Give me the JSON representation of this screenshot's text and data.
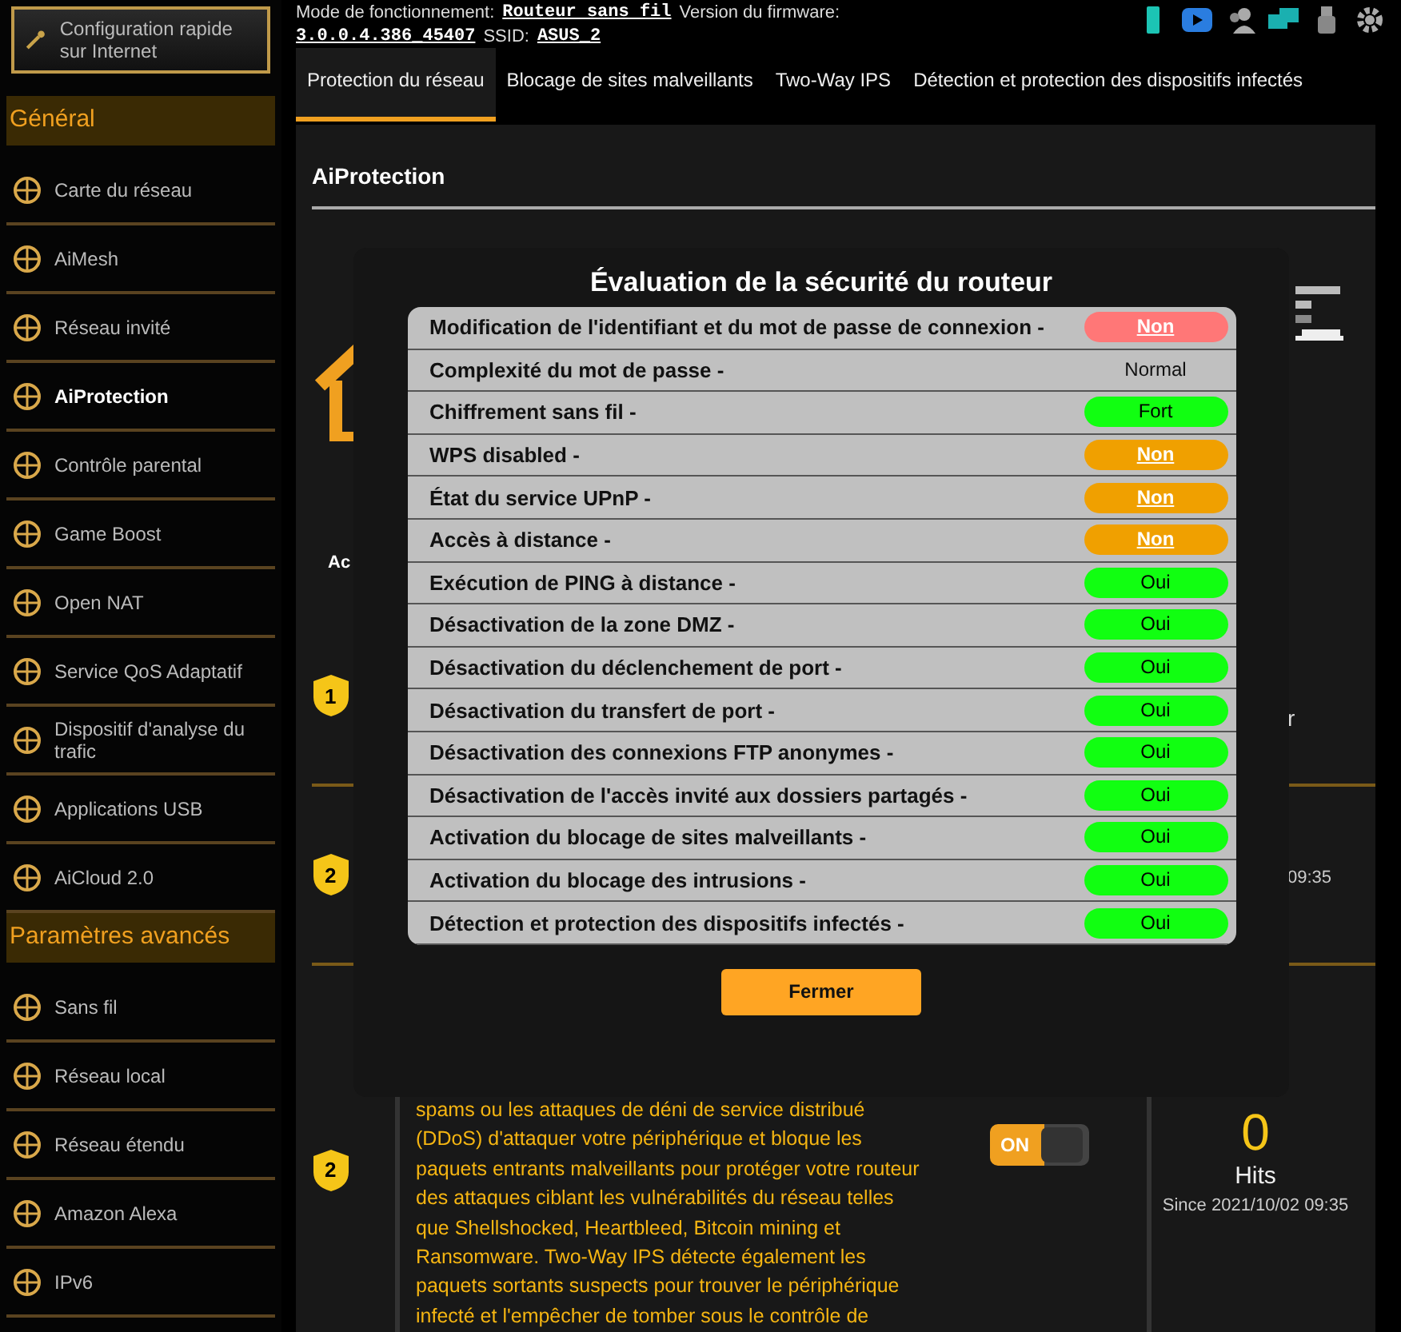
{
  "quick_setup": {
    "label": "Configuration rapide sur Internet"
  },
  "sidebar": {
    "sections": [
      {
        "title": "Général",
        "items": [
          {
            "label": "Carte du réseau",
            "selected": false
          },
          {
            "label": "AiMesh",
            "selected": false
          },
          {
            "label": "Réseau invité",
            "selected": false
          },
          {
            "label": "AiProtection",
            "selected": true
          },
          {
            "label": "Contrôle parental",
            "selected": false
          },
          {
            "label": "Game Boost",
            "selected": false
          },
          {
            "label": "Open NAT",
            "selected": false
          },
          {
            "label": "Service QoS Adaptatif",
            "selected": false
          },
          {
            "label": "Dispositif d'analyse du trafic",
            "selected": false
          },
          {
            "label": "Applications USB",
            "selected": false
          },
          {
            "label": "AiCloud 2.0",
            "selected": false
          }
        ]
      },
      {
        "title": "Paramètres avancés",
        "items": [
          {
            "label": "Sans fil",
            "selected": false
          },
          {
            "label": "Réseau local",
            "selected": false
          },
          {
            "label": "Réseau étendu",
            "selected": false
          },
          {
            "label": "Amazon Alexa",
            "selected": false
          },
          {
            "label": "IPv6",
            "selected": false
          }
        ]
      }
    ]
  },
  "header": {
    "mode_label": "Mode de fonctionnement:",
    "mode_value": "Routeur sans fil",
    "version_label": "Version du firmware:",
    "version_value": "3.0.0.4.386_45407",
    "ssid_label": "SSID:",
    "ssid_value": "ASUS_2"
  },
  "tabs": [
    {
      "label": "Protection du réseau",
      "selected": true
    },
    {
      "label": "Blocage de sites malveillants",
      "selected": false
    },
    {
      "label": "Two-Way IPS",
      "selected": false
    },
    {
      "label": "Détection et protection des dispositifs infectés",
      "selected": false
    }
  ],
  "panel": {
    "title": "AiProtection",
    "enable_label": "Ac",
    "cards": [
      {
        "badge": "1",
        "kind": "danger",
        "status": "r"
      },
      {
        "badge": "2",
        "kind": "hits",
        "since": "09:35"
      },
      {
        "badge": "2",
        "kind": "hits",
        "description": "spams ou les attaques de déni de service distribué (DDoS) d'attaquer votre périphérique et bloque les paquets entrants malveillants pour protéger votre routeur des attaques ciblant les vulnérabilités du réseau telles que Shellshocked, Heartbleed, Bitcoin mining et Ransomware. Two-Way IPS détecte également les paquets sortants suspects pour trouver le périphérique infecté et l'empêcher de tomber sous le contrôle de",
        "toggle": {
          "label": "ON",
          "on": true
        },
        "count": "0",
        "status": "Hits",
        "since": "Since 2021/10/02 09:35"
      }
    ]
  },
  "modal": {
    "title": "Évaluation de la sécurité du routeur",
    "rows": [
      {
        "label": "Modification de l'identifiant et du mot de passe de connexion -",
        "value": "Non",
        "kind": "bad"
      },
      {
        "label": "Complexité du mot de passe -",
        "value": "Normal",
        "kind": "plain"
      },
      {
        "label": "Chiffrement sans fil -",
        "value": "Fort",
        "kind": "good"
      },
      {
        "label": "WPS disabled -",
        "value": "Non",
        "kind": "warn"
      },
      {
        "label": "État du service UPnP -",
        "value": "Non",
        "kind": "warn"
      },
      {
        "label": "Accès à distance -",
        "value": "Non",
        "kind": "warn"
      },
      {
        "label": "Exécution de PING à distance -",
        "value": "Oui",
        "kind": "good"
      },
      {
        "label": "Désactivation de la zone DMZ -",
        "value": "Oui",
        "kind": "good"
      },
      {
        "label": "Désactivation du déclenchement de port -",
        "value": "Oui",
        "kind": "good"
      },
      {
        "label": "Désactivation du transfert de port -",
        "value": "Oui",
        "kind": "good"
      },
      {
        "label": "Désactivation des connexions FTP anonymes -",
        "value": "Oui",
        "kind": "good"
      },
      {
        "label": "Désactivation de l'accès invité aux dossiers partagés -",
        "value": "Oui",
        "kind": "good"
      },
      {
        "label": "Activation du blocage de sites malveillants -",
        "value": "Oui",
        "kind": "good"
      },
      {
        "label": "Activation du blocage des intrusions -",
        "value": "Oui",
        "kind": "good"
      },
      {
        "label": "Détection et protection des dispositifs infectés -",
        "value": "Oui",
        "kind": "good"
      }
    ],
    "button": "Fermer"
  }
}
